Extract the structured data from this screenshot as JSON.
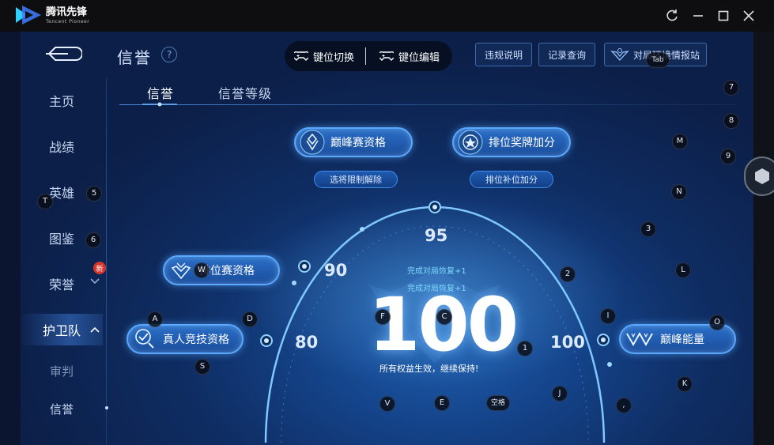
{
  "titlebar": {
    "brand": "腾讯先锋",
    "brand_sub": "Tencent Pioneer",
    "controls": [
      "refresh-icon",
      "minimize-icon",
      "maximize-icon",
      "close-icon"
    ]
  },
  "header": {
    "title": "信誉",
    "help": "?",
    "toggle_key_switch": "键位切换",
    "toggle_key_edit": "键位编辑",
    "btn_violation": "违规说明",
    "btn_records": "记录查询",
    "btn_report": "对局环境情报站"
  },
  "sidebar": {
    "items": [
      "主页",
      "战绩",
      "英雄",
      "图鉴",
      "荣誉",
      "护卫队",
      "审判",
      "信誉"
    ],
    "new_badge": "新",
    "active_index": 5
  },
  "tabs": [
    "信誉",
    "信誉等级"
  ],
  "privileges": {
    "peak_qualification": "巅峰赛资格",
    "rank_medal_bonus": "排位奖牌加分",
    "pick_limit_lift": "选将限制解除",
    "rank_fill_bonus": "排位补位加分",
    "rank_qualification": "排位赛资格",
    "real_competitive": "真人竞技资格",
    "peak_energy": "巅峰能量"
  },
  "gauge": {
    "thresholds": [
      "80",
      "90",
      "95",
      "100"
    ],
    "score": "100",
    "recover_1": "完成对局恢复+1",
    "recover_2": "完成对局恢复+1",
    "status": "所有权益生效，继续保持!"
  },
  "key_overlay": [
    {
      "label": "Tab"
    },
    {
      "label": "7"
    },
    {
      "label": "8"
    },
    {
      "label": "M"
    },
    {
      "label": "9"
    },
    {
      "label": "5"
    },
    {
      "label": "T"
    },
    {
      "label": "N"
    },
    {
      "label": "6"
    },
    {
      "label": "3"
    },
    {
      "label": "W"
    },
    {
      "label": "2"
    },
    {
      "label": "L"
    },
    {
      "label": "A"
    },
    {
      "label": "D"
    },
    {
      "label": "F"
    },
    {
      "label": "C"
    },
    {
      "label": "I"
    },
    {
      "label": "O"
    },
    {
      "label": "1"
    },
    {
      "label": "S"
    },
    {
      "label": "K"
    },
    {
      "label": "J"
    },
    {
      "label": "V"
    },
    {
      "label": "E"
    },
    {
      "label": "空格"
    },
    {
      "label": ","
    }
  ]
}
